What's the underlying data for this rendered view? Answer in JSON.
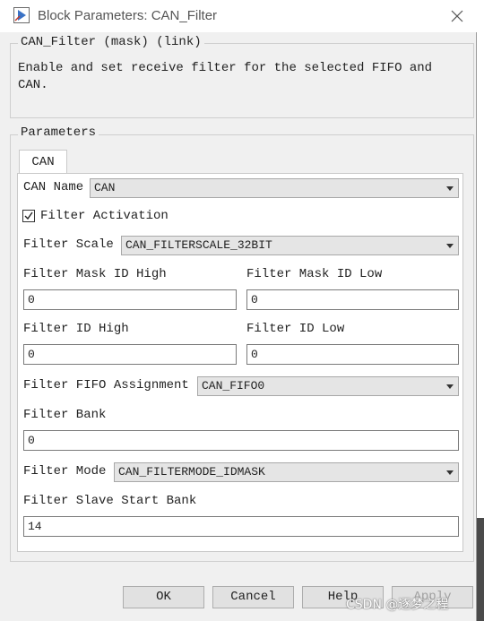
{
  "window": {
    "title": "Block Parameters: CAN_Filter",
    "icon": "simulink-block-icon",
    "close": "close-icon"
  },
  "block_info": {
    "heading": "CAN_Filter (mask) (link)",
    "description": "Enable and set receive filter for the selected FIFO and\nCAN."
  },
  "parameters": {
    "legend": "Parameters",
    "tab_label": "CAN",
    "can_name_label": "CAN Name",
    "can_name_value": "CAN",
    "filter_activation_label": "Filter Activation",
    "filter_activation_checked": true,
    "filter_scale_label": "Filter Scale",
    "filter_scale_value": "CAN_FILTERSCALE_32BIT",
    "mask_id_high_label": "Filter Mask ID High",
    "mask_id_high_value": "0",
    "mask_id_low_label": "Filter Mask ID Low",
    "mask_id_low_value": "0",
    "id_high_label": "Filter ID High",
    "id_high_value": "0",
    "id_low_label": "Filter ID Low",
    "id_low_value": "0",
    "fifo_assignment_label": "Filter FIFO Assignment",
    "fifo_assignment_value": "CAN_FIFO0",
    "bank_label": "Filter Bank",
    "bank_value": "0",
    "mode_label": "Filter Mode",
    "mode_value": "CAN_FILTERMODE_IDMASK",
    "slave_start_bank_label": "Filter Slave Start Bank",
    "slave_start_bank_value": "14"
  },
  "buttons": {
    "ok": "OK",
    "cancel": "Cancel",
    "help": "Help",
    "apply": "Apply"
  },
  "watermark": "CSDN @逐梦之程"
}
